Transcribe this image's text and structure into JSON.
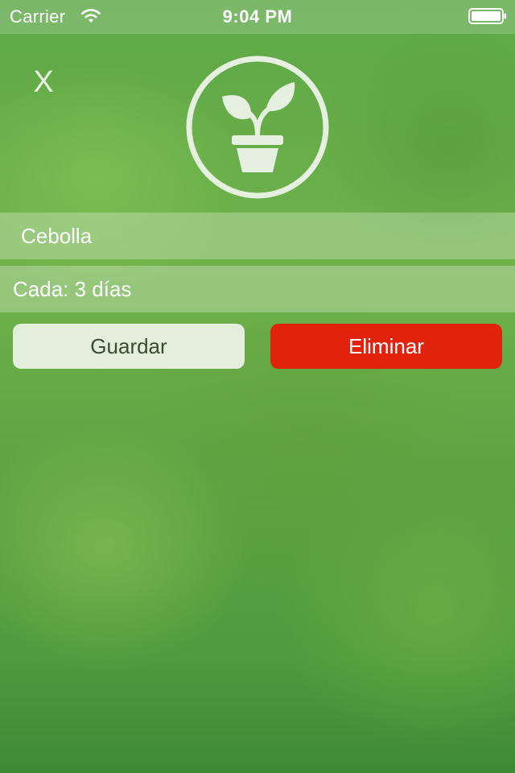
{
  "status_bar": {
    "carrier": "Carrier",
    "time": "9:04 PM",
    "wifi_icon": "wifi-icon",
    "battery_icon": "battery-icon"
  },
  "header": {
    "close_label": "X",
    "logo_icon": "plant-icon"
  },
  "form": {
    "name_value": "Cebolla",
    "frequency_value": "Cada: 3 días"
  },
  "actions": {
    "save_label": "Guardar",
    "delete_label": "Eliminar"
  },
  "colors": {
    "accent_delete": "#e1230d",
    "save_background": "#e3eedd",
    "background_green": "#5fa444"
  }
}
